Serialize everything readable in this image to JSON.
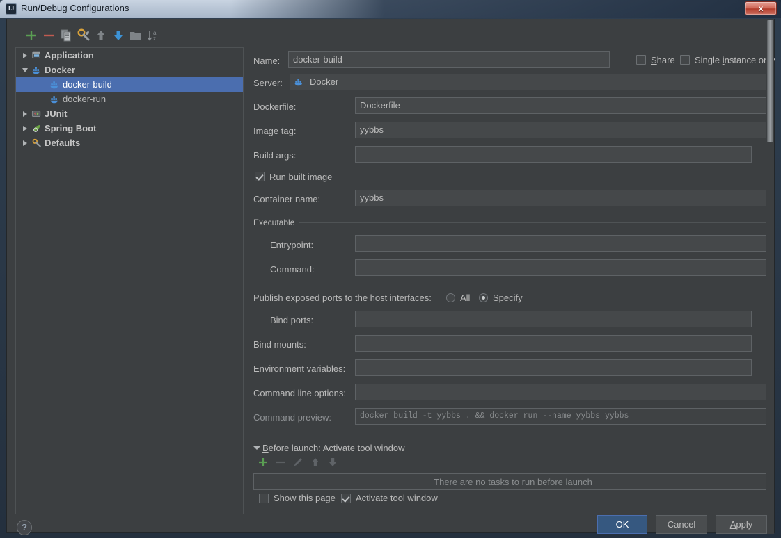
{
  "window": {
    "title": "Run/Debug Configurations",
    "app_icon": "intellij-idea-icon",
    "close_label": "x"
  },
  "toolbar": {
    "items": [
      {
        "name": "add-configuration-button",
        "icon": "plus-icon",
        "label": "Add New Configuration"
      },
      {
        "name": "remove-configuration-button",
        "icon": "minus-icon",
        "label": "Remove Configuration"
      },
      {
        "name": "copy-configuration-button",
        "icon": "copy-icon",
        "label": "Copy Configuration"
      },
      {
        "name": "edit-defaults-button",
        "icon": "wrench-icon",
        "label": "Edit Defaults"
      },
      {
        "name": "move-up-button",
        "icon": "arrow-up-icon",
        "label": "Move Up"
      },
      {
        "name": "move-down-button",
        "icon": "arrow-down-icon",
        "label": "Move Down"
      },
      {
        "name": "new-folder-button",
        "icon": "folder-icon",
        "label": "Create New Folder"
      },
      {
        "name": "sort-button",
        "icon": "sort-alphabetical-icon",
        "label": "Sort Configurations"
      }
    ]
  },
  "tree": {
    "items": [
      {
        "label": "Application",
        "icon": "application-icon",
        "indent": 0,
        "arrow": "collapsed",
        "bold": true,
        "selected": false
      },
      {
        "label": "Docker",
        "icon": "docker-icon",
        "indent": 0,
        "arrow": "expanded",
        "bold": true,
        "selected": false
      },
      {
        "label": "docker-build",
        "icon": "docker-icon",
        "indent": 1,
        "arrow": "none",
        "bold": false,
        "selected": true
      },
      {
        "label": "docker-run",
        "icon": "docker-icon",
        "indent": 1,
        "arrow": "none",
        "bold": false,
        "selected": false
      },
      {
        "label": "JUnit",
        "icon": "junit-icon",
        "indent": 0,
        "arrow": "collapsed",
        "bold": true,
        "selected": false
      },
      {
        "label": "Spring Boot",
        "icon": "spring-boot-icon",
        "indent": 0,
        "arrow": "collapsed",
        "bold": true,
        "selected": false
      },
      {
        "label": "Defaults",
        "icon": "defaults-icon",
        "indent": 0,
        "arrow": "collapsed",
        "bold": true,
        "selected": false
      }
    ]
  },
  "form": {
    "name_label": "Name:",
    "name_value": "docker-build",
    "share_label": "Share",
    "share_checked": false,
    "single_instance_label": "Single instance only",
    "single_instance_checked": false,
    "server_label": "Server:",
    "server_value": "Docker",
    "dockerfile_label": "Dockerfile:",
    "dockerfile_value": "Dockerfile",
    "image_tag_label": "Image tag:",
    "image_tag_value": "yybbs",
    "build_args_label": "Build args:",
    "build_args_value": "",
    "run_built_image_label": "Run built image",
    "run_built_image_checked": true,
    "container_name_label": "Container name:",
    "container_name_value": "yybbs",
    "executable_group_label": "Executable",
    "entrypoint_label": "Entrypoint:",
    "entrypoint_value": "",
    "command_label": "Command:",
    "command_value": "",
    "publish_ports_label": "Publish exposed ports to the host interfaces:",
    "publish_all_label": "All",
    "publish_specify_label": "Specify",
    "publish_selected": "Specify",
    "bind_ports_label": "Bind ports:",
    "bind_ports_value": "",
    "bind_mounts_label": "Bind mounts:",
    "bind_mounts_value": "",
    "env_vars_label": "Environment variables:",
    "env_vars_value": "",
    "cmd_line_options_label": "Command line options:",
    "cmd_line_options_value": "",
    "command_preview_label": "Command preview:",
    "command_preview_value": "docker build -t yybbs . && docker run --name yybbs yybbs",
    "browse_label": "..."
  },
  "before_launch": {
    "header": "Before launch: Activate tool window",
    "toolbar": [
      {
        "name": "add-task-button",
        "icon": "plus-icon",
        "enabled": true
      },
      {
        "name": "remove-task-button",
        "icon": "minus-icon",
        "enabled": false
      },
      {
        "name": "edit-task-button",
        "icon": "pencil-icon",
        "enabled": false
      },
      {
        "name": "task-move-up-button",
        "icon": "arrow-up-icon",
        "enabled": false
      },
      {
        "name": "task-move-down-button",
        "icon": "arrow-down-icon",
        "enabled": false
      }
    ],
    "empty_text": "There are no tasks to run before launch",
    "show_page_label": "Show this page",
    "show_page_checked": false,
    "activate_tool_window_label": "Activate tool window",
    "activate_tool_window_checked": true
  },
  "buttons": {
    "help_label": "?",
    "ok_label": "OK",
    "cancel_label": "Cancel",
    "apply_label": "Apply"
  },
  "colors": {
    "background": "#3c3f41",
    "field_background": "#45484a",
    "selection": "#4b6eaf",
    "primary_button": "#365880",
    "accent_green": "#5a9e53",
    "accent_red": "#c75450",
    "docker_blue": "#4a90d9"
  }
}
